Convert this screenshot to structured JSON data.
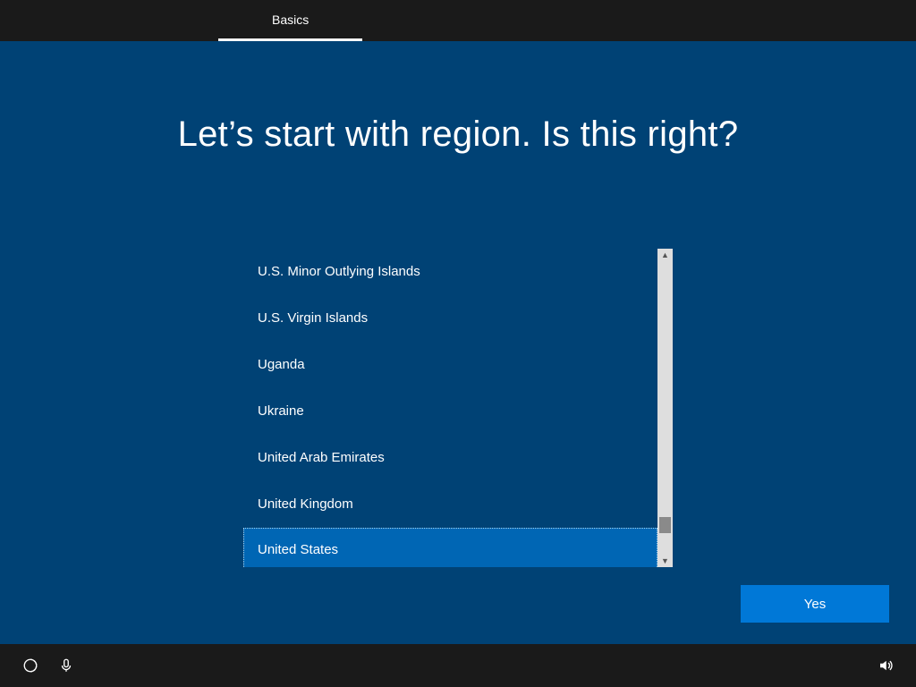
{
  "tabs": {
    "active": "Basics"
  },
  "title": "Let’s start with region. Is this right?",
  "regions": {
    "items": [
      "U.S. Minor Outlying Islands",
      "U.S. Virgin Islands",
      "Uganda",
      "Ukraine",
      "United Arab Emirates",
      "United Kingdom",
      "United States"
    ],
    "selected_index": 6
  },
  "buttons": {
    "yes": "Yes"
  }
}
